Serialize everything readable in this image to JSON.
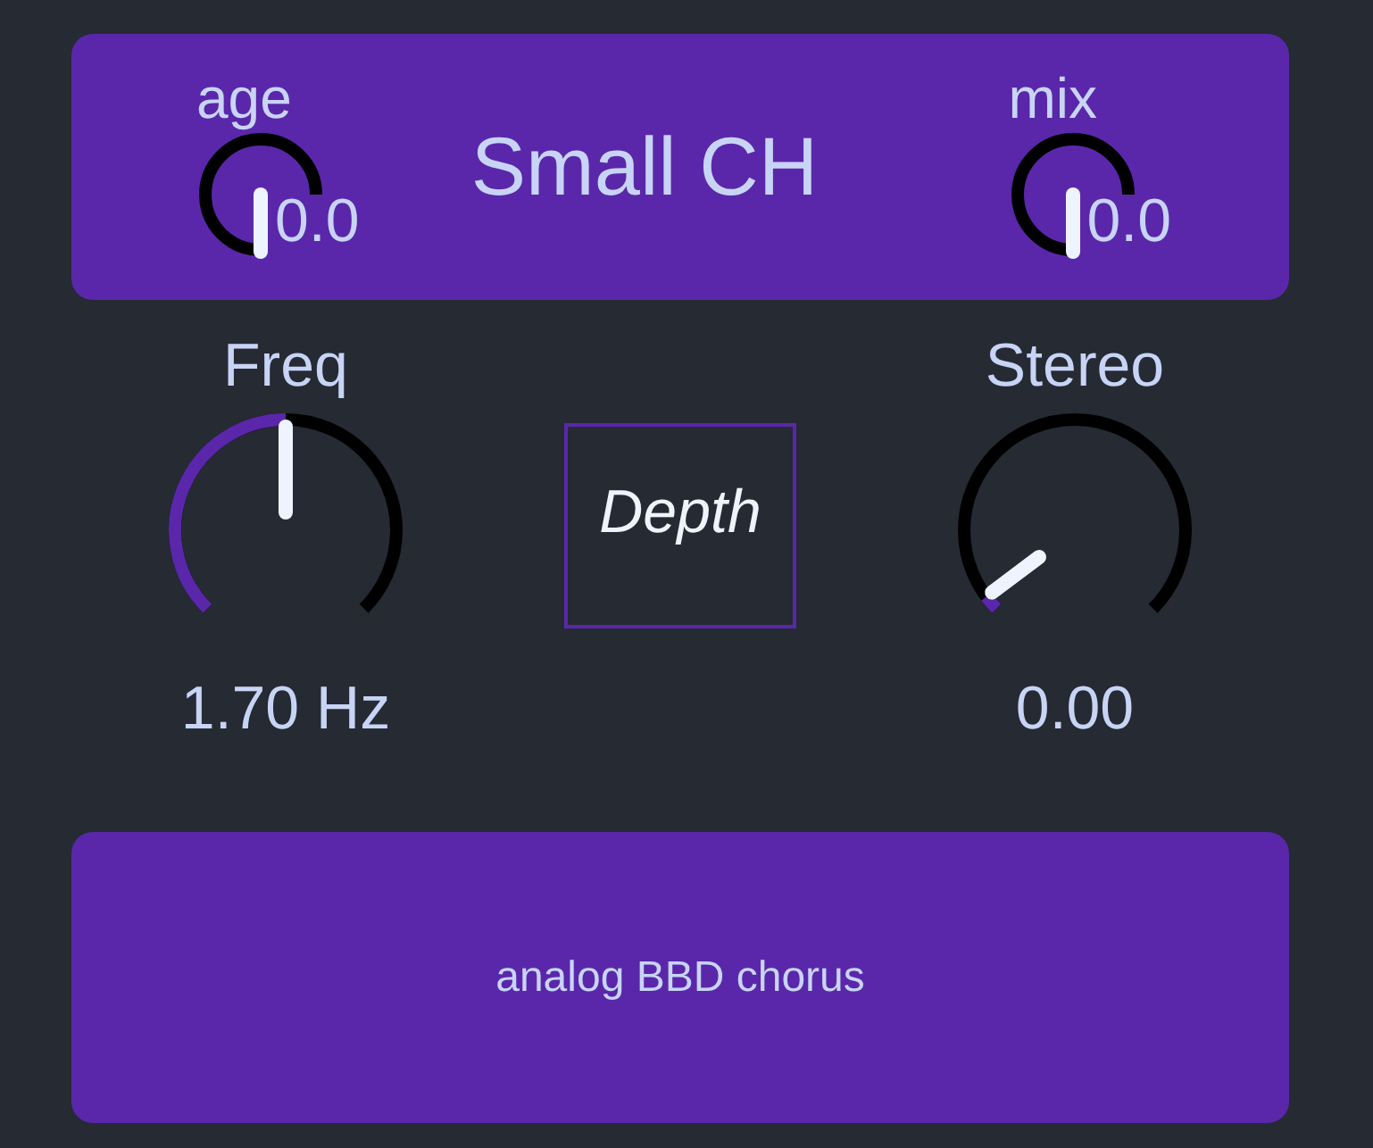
{
  "header": {
    "title": "Small CH",
    "knobs": [
      {
        "label": "age",
        "value": "0.0"
      },
      {
        "label": "mix",
        "value": "0.0"
      }
    ]
  },
  "controls": [
    {
      "kind": "knob",
      "label": "Freq",
      "value": "1.70 Hz"
    },
    {
      "kind": "button",
      "label": "Depth"
    },
    {
      "kind": "knob",
      "label": "Stereo",
      "value": "0.00"
    }
  ],
  "footer": {
    "description": "analog BBD chorus"
  }
}
